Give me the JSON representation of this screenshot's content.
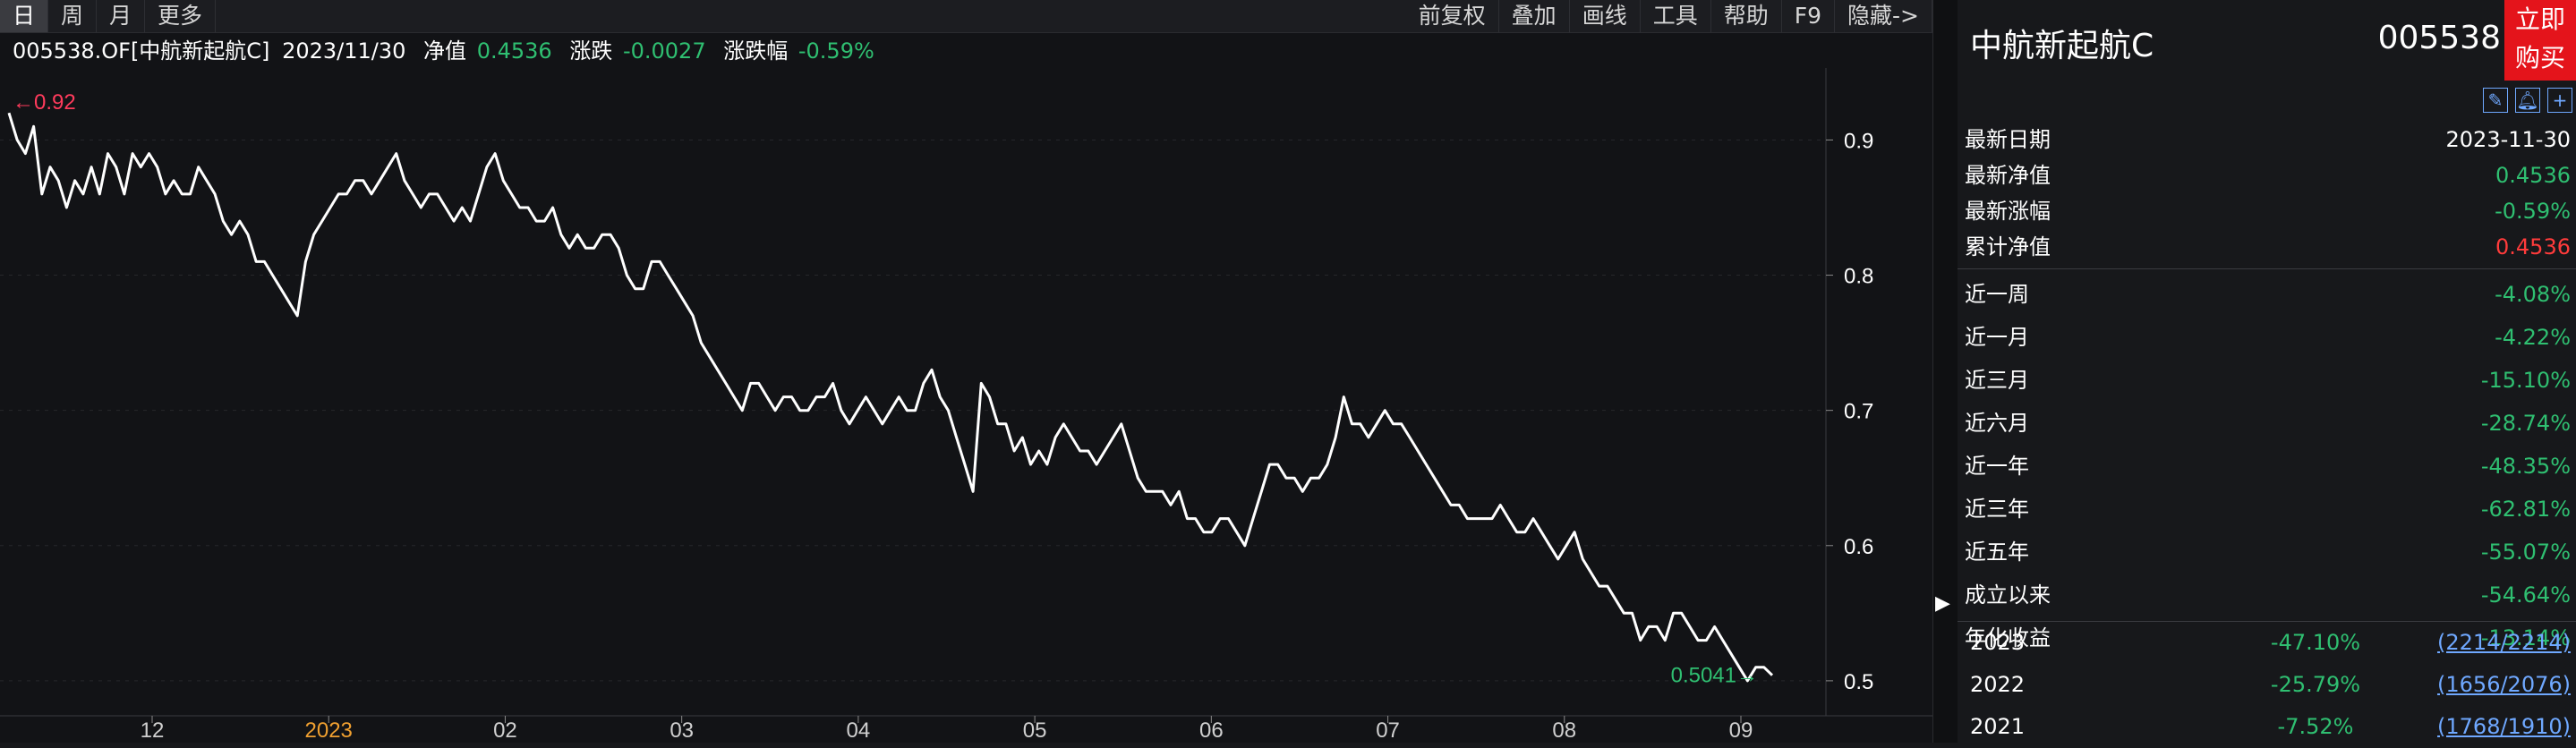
{
  "toolbar": {
    "left_items": [
      "日",
      "周",
      "月",
      "更多"
    ],
    "right_items": [
      "前复权",
      "叠加",
      "画线",
      "工具",
      "帮助",
      "F9",
      "隐藏->"
    ]
  },
  "info": {
    "code": "005538.OF[中航新起航C]",
    "date": "2023/11/30",
    "nav_label": "净值",
    "nav_value": "0.4536",
    "change_label": "涨跌",
    "change_value": "-0.0027",
    "pct_label": "涨跌幅",
    "pct_value": "-0.59%"
  },
  "chart_data": {
    "type": "line",
    "title": "",
    "xlabel": "",
    "ylabel": "",
    "ylim": [
      0.49,
      0.94
    ],
    "y_ticks": [
      "0.9",
      "0.8",
      "0.7",
      "0.6",
      "0.5"
    ],
    "x_tick_labels": [
      "12",
      "2023",
      "02",
      "03",
      "04",
      "05",
      "06",
      "07",
      "08",
      "09"
    ],
    "max_annotation": "0.92",
    "min_annotation": "0.5041",
    "series": [
      {
        "color": "#ffffff",
        "values": [
          0.92,
          0.9,
          0.89,
          0.91,
          0.86,
          0.88,
          0.87,
          0.85,
          0.87,
          0.86,
          0.88,
          0.86,
          0.89,
          0.88,
          0.86,
          0.89,
          0.88,
          0.89,
          0.88,
          0.86,
          0.87,
          0.86,
          0.86,
          0.88,
          0.87,
          0.86,
          0.84,
          0.83,
          0.84,
          0.83,
          0.81,
          0.81,
          0.8,
          0.79,
          0.78,
          0.77,
          0.81,
          0.83,
          0.84,
          0.85,
          0.86,
          0.86,
          0.87,
          0.87,
          0.86,
          0.87,
          0.88,
          0.89,
          0.87,
          0.86,
          0.85,
          0.86,
          0.86,
          0.85,
          0.84,
          0.85,
          0.84,
          0.86,
          0.88,
          0.89,
          0.87,
          0.86,
          0.85,
          0.85,
          0.84,
          0.84,
          0.85,
          0.83,
          0.82,
          0.83,
          0.82,
          0.82,
          0.83,
          0.83,
          0.82,
          0.8,
          0.79,
          0.79,
          0.81,
          0.81,
          0.8,
          0.79,
          0.78,
          0.77,
          0.75,
          0.74,
          0.73,
          0.72,
          0.71,
          0.7,
          0.72,
          0.72,
          0.71,
          0.7,
          0.71,
          0.71,
          0.7,
          0.7,
          0.71,
          0.71,
          0.72,
          0.7,
          0.69,
          0.7,
          0.71,
          0.7,
          0.69,
          0.7,
          0.71,
          0.7,
          0.7,
          0.72,
          0.73,
          0.71,
          0.7,
          0.68,
          0.66,
          0.64,
          0.72,
          0.71,
          0.69,
          0.69,
          0.67,
          0.68,
          0.66,
          0.67,
          0.66,
          0.68,
          0.69,
          0.68,
          0.67,
          0.67,
          0.66,
          0.67,
          0.68,
          0.69,
          0.67,
          0.65,
          0.64,
          0.64,
          0.64,
          0.63,
          0.64,
          0.62,
          0.62,
          0.61,
          0.61,
          0.62,
          0.62,
          0.61,
          0.6,
          0.62,
          0.64,
          0.66,
          0.66,
          0.65,
          0.65,
          0.64,
          0.65,
          0.65,
          0.66,
          0.68,
          0.71,
          0.69,
          0.69,
          0.68,
          0.69,
          0.7,
          0.69,
          0.69,
          0.68,
          0.67,
          0.66,
          0.65,
          0.64,
          0.63,
          0.63,
          0.62,
          0.62,
          0.62,
          0.62,
          0.63,
          0.62,
          0.61,
          0.61,
          0.62,
          0.61,
          0.6,
          0.59,
          0.6,
          0.61,
          0.59,
          0.58,
          0.57,
          0.57,
          0.56,
          0.55,
          0.55,
          0.53,
          0.54,
          0.54,
          0.53,
          0.55,
          0.55,
          0.54,
          0.53,
          0.53,
          0.54,
          0.53,
          0.52,
          0.51,
          0.5,
          0.51,
          0.51,
          0.5041
        ]
      }
    ]
  },
  "side": {
    "fund_name": "中航新起航C",
    "fund_code": "005538",
    "buy_line1": "立即",
    "buy_line2": "购买",
    "icons": [
      "edit-icon",
      "bell-icon",
      "plus-icon"
    ],
    "stats": [
      {
        "label": "最新日期",
        "value": "2023-11-30",
        "color": "#ffffff"
      },
      {
        "label": "最新净值",
        "value": "0.4536",
        "color": "#2fbf71"
      },
      {
        "label": "最新涨幅",
        "value": "-0.59%",
        "color": "#2fbf71"
      },
      {
        "label": "累计净值",
        "value": "0.4536",
        "color": "#ff3b3b"
      }
    ],
    "periods": [
      {
        "label": "近一周",
        "value": "-4.08%"
      },
      {
        "label": "近一月",
        "value": "-4.22%"
      },
      {
        "label": "近三月",
        "value": "-15.10%"
      },
      {
        "label": "近六月",
        "value": "-28.74%"
      },
      {
        "label": "近一年",
        "value": "-48.35%"
      },
      {
        "label": "近三年",
        "value": "-62.81%"
      },
      {
        "label": "近五年",
        "value": "-55.07%"
      },
      {
        "label": "成立以来",
        "value": "-54.64%"
      },
      {
        "label": "年化收益",
        "value": "-13.14%"
      }
    ],
    "years": [
      {
        "year": "2023",
        "pct": "-47.10%",
        "rank": "(2214/2214)"
      },
      {
        "year": "2022",
        "pct": "-25.79%",
        "rank": "(1656/2076)"
      },
      {
        "year": "2021",
        "pct": "-7.52%",
        "rank": "(1768/1910)"
      }
    ]
  }
}
